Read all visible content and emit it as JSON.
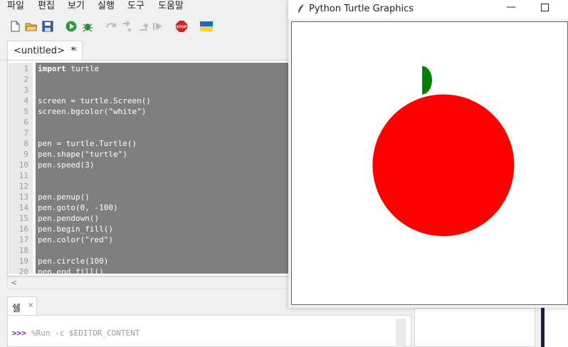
{
  "menu": [
    "파일",
    "편집",
    "보기",
    "실행",
    "도구",
    "도움말"
  ],
  "toolbar": {
    "icons": [
      "new-file-icon",
      "open-folder-icon",
      "save-icon",
      "run-icon",
      "debug-icon",
      "step-over-icon",
      "step-into-icon",
      "step-out-icon",
      "resume-icon",
      "stop-icon",
      "ukraine-flag-icon"
    ],
    "stop_label": "STOP"
  },
  "editor": {
    "tab_label": "<untitled>  *",
    "tab_close": "×",
    "line_numbers": [
      "1",
      "2",
      "3",
      "4",
      "5",
      "6",
      "7",
      "8",
      "9",
      "10",
      "11",
      "12",
      "13",
      "14",
      "15",
      "16",
      "17",
      "18",
      "19",
      "20"
    ],
    "lines": [
      {
        "kw": "import",
        "rest": " turtle"
      },
      {
        "kw": "",
        "rest": ""
      },
      {
        "kw": "",
        "rest": ""
      },
      {
        "kw": "",
        "rest": "screen = turtle.Screen()"
      },
      {
        "kw": "",
        "rest": "screen.bgcolor(\"white\")"
      },
      {
        "kw": "",
        "rest": ""
      },
      {
        "kw": "",
        "rest": ""
      },
      {
        "kw": "",
        "rest": "pen = turtle.Turtle()"
      },
      {
        "kw": "",
        "rest": "pen.shape(\"turtle\")"
      },
      {
        "kw": "",
        "rest": "pen.speed(3)"
      },
      {
        "kw": "",
        "rest": ""
      },
      {
        "kw": "",
        "rest": ""
      },
      {
        "kw": "",
        "rest": "pen.penup()"
      },
      {
        "kw": "",
        "rest": "pen.goto(0, -100)"
      },
      {
        "kw": "",
        "rest": "pen.pendown()"
      },
      {
        "kw": "",
        "rest": "pen.begin_fill()"
      },
      {
        "kw": "",
        "rest": "pen.color(\"red\")"
      },
      {
        "kw": "",
        "rest": ""
      },
      {
        "kw": "",
        "rest": "pen.circle(100)"
      },
      {
        "kw": "",
        "rest": "pen.end_fill()"
      }
    ],
    "selection_color": "#7f7f7f"
  },
  "shell": {
    "tab_label": "쉘",
    "tab_close": "×",
    "prompt": ">>>",
    "command": "%Run -c $EDITOR_CONTENT"
  },
  "turtle_window": {
    "title": "Python Turtle Graphics",
    "minimize": "—",
    "apple_color": "#ff0000",
    "leaf_color": "#008000"
  }
}
